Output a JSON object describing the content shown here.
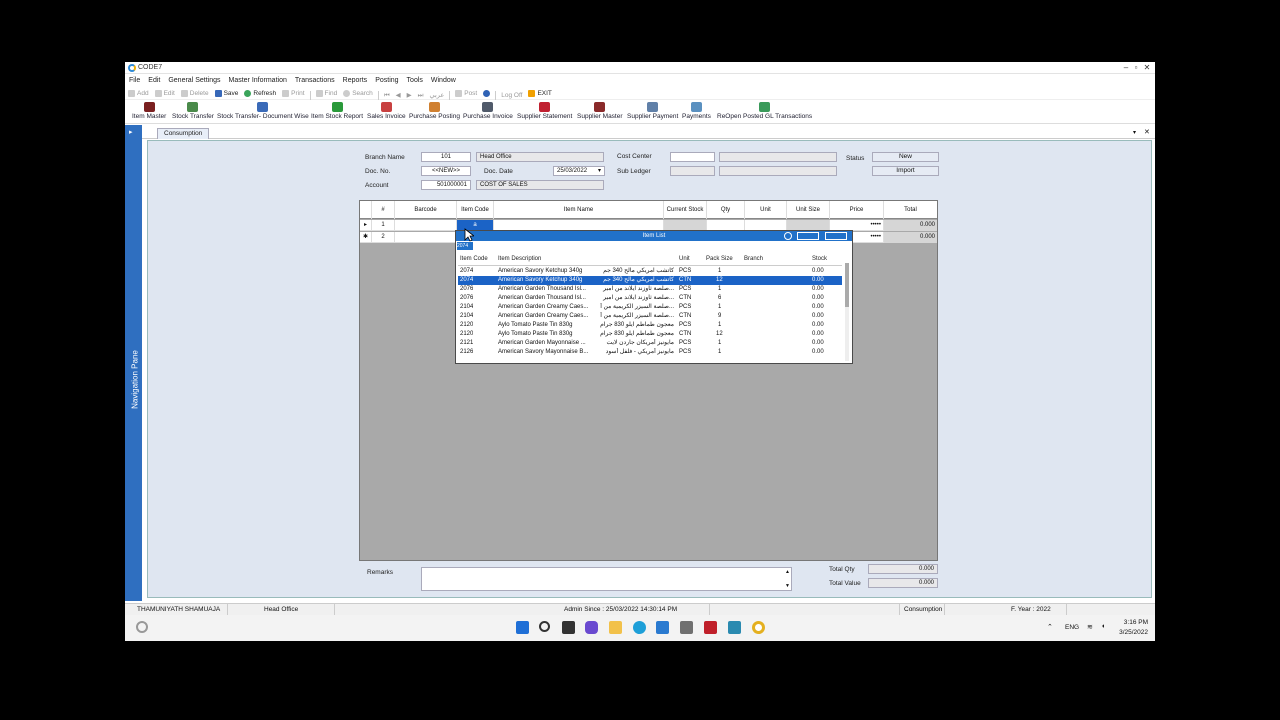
{
  "app": {
    "title": "CODE7"
  },
  "menu": [
    "File",
    "Edit",
    "General Settings",
    "Master Information",
    "Transactions",
    "Reports",
    "Posting",
    "Tools",
    "Window"
  ],
  "toolbar": {
    "add": "Add",
    "edit": "Edit",
    "delete": "Delete",
    "save": "Save",
    "refresh": "Refresh",
    "print": "Print",
    "find": "Find",
    "search": "Search",
    "arabic": "عربي",
    "post": "Post",
    "logoff": "Log Off",
    "exit": "EXIT"
  },
  "ribbon": [
    "Item Master",
    "Stock Transfer",
    "Stock Transfer- Document Wise",
    "Item Stock Report",
    "Sales Invoice",
    "Purchase Posting",
    "Purchase Invoice",
    "Supplier Statement",
    "Supplier Master",
    "Supplier Payment",
    "Payments",
    "ReOpen Posted GL Transactions"
  ],
  "tab": {
    "label": "Consumption"
  },
  "navpane": {
    "label": "Navigation Pane"
  },
  "form": {
    "branch_label": "Branch Name",
    "branch_code": "101",
    "branch_name": "Head Office",
    "docno_label": "Doc. No.",
    "docno_value": "<<NEW>>",
    "docdate_label": "Doc. Date",
    "docdate_value": "25/03/2022",
    "account_label": "Account",
    "account_code": "501000001",
    "account_name": "COST OF SALES",
    "costcenter_label": "Cost Center",
    "subledger_label": "Sub Ledger",
    "status_label": "Status",
    "status_value": "New",
    "import_label": "Import"
  },
  "grid": {
    "headers": [
      "#",
      "Barcode",
      "Item Code",
      "Item Name",
      "Current Stock",
      "Qty",
      "Unit",
      "Unit Size",
      "Price",
      "Total"
    ],
    "rows": [
      {
        "num": "1",
        "code": "a",
        "price": "•••••",
        "total": "0.000"
      },
      {
        "num": "2",
        "code": "",
        "price": "•••••",
        "total": "0.000"
      }
    ]
  },
  "popup": {
    "title": "Item List",
    "search_text": "2074",
    "headers": [
      "Item Code",
      "Item Description",
      "Unit",
      "Pack Size",
      "Branch",
      "Stock"
    ],
    "rows": [
      {
        "code": "2074",
        "desc": "American Savory Ketchup 340g",
        "ar": "كاتشب امريكي مالح 340 جم",
        "unit": "PCS",
        "pack": "1",
        "stock": "0.00"
      },
      {
        "code": "2074",
        "desc": "American Savory Ketchup 340g",
        "ar": "كاتشب امريكي مالح 340 جم",
        "unit": "CTN",
        "pack": "12",
        "stock": "0.00"
      },
      {
        "code": "2076",
        "desc": "American Garden Thousand Isl...",
        "ar": "صلصة ثاوزند آيلاند من امير...",
        "unit": "PCS",
        "pack": "1",
        "stock": "0.00"
      },
      {
        "code": "2076",
        "desc": "American Garden Thousand Isl...",
        "ar": "صلصة ثاوزند آيلاند من امير...",
        "unit": "CTN",
        "pack": "6",
        "stock": "0.00"
      },
      {
        "code": "2104",
        "desc": "American Garden Creamy Caes...",
        "ar": "صلصة السيزر الكريمية من أ...",
        "unit": "PCS",
        "pack": "1",
        "stock": "0.00"
      },
      {
        "code": "2104",
        "desc": "American Garden Creamy Caes...",
        "ar": "صلصة السيزر الكريمية من أ...",
        "unit": "CTN",
        "pack": "9",
        "stock": "0.00"
      },
      {
        "code": "2120",
        "desc": "Aylo Tomato Paste Tin 830g",
        "ar": "معجون طماطم ايلو 830 جرام",
        "unit": "PCS",
        "pack": "1",
        "stock": "0.00"
      },
      {
        "code": "2120",
        "desc": "Aylo Tomato Paste Tin 830g",
        "ar": "معجون طماطم ايلو 830 جرام",
        "unit": "CTN",
        "pack": "12",
        "stock": "0.00"
      },
      {
        "code": "2121",
        "desc": "American Garden Mayonnaise ...",
        "ar": "مايونيز أمريكان جاردن لايت",
        "unit": "PCS",
        "pack": "1",
        "stock": "0.00"
      },
      {
        "code": "2126",
        "desc": "American Savory Mayonnaise B...",
        "ar": "مايونيز أمريكي - فلفل أسود",
        "unit": "PCS",
        "pack": "1",
        "stock": "0.00"
      }
    ]
  },
  "footer": {
    "remarks_label": "Remarks",
    "totalqty_label": "Total Qty",
    "totalqty_value": "0.000",
    "totalvalue_label": "Total Value",
    "totalvalue_value": "0.000"
  },
  "statusbar": {
    "user": "THAMUNIYATH SHAMUAJA",
    "branch": "Head Office",
    "admin_since": "Admin Since : 25/03/2022 14:30:14 PM",
    "form": "Consumption",
    "fyear": "F. Year : 2022"
  },
  "taskbar": {
    "lang": "ENG",
    "time": "3:16 PM",
    "date": "3/25/2022"
  }
}
